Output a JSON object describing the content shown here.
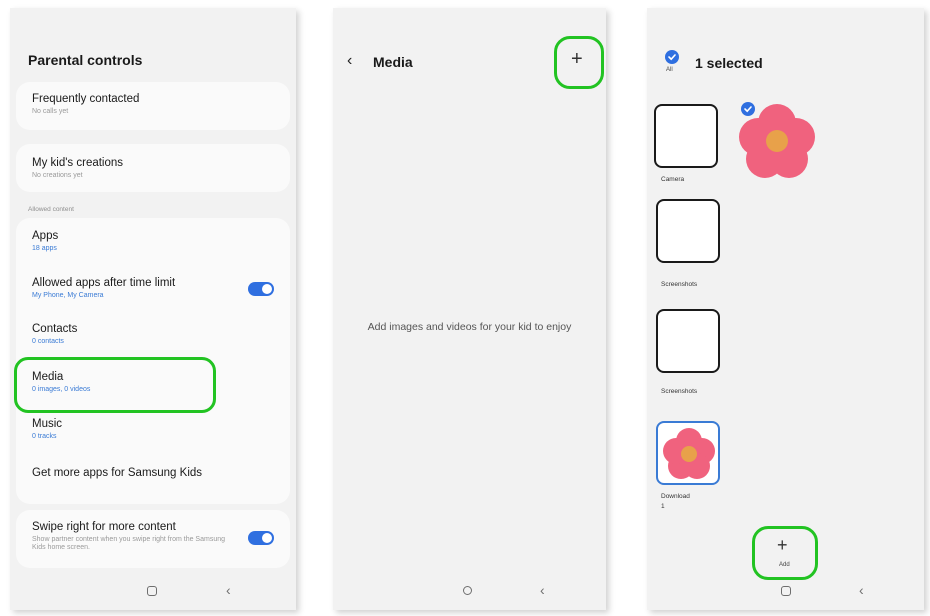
{
  "panel1": {
    "title": "Parental controls",
    "frequently_contacted": {
      "title": "Frequently contacted",
      "sub": "No calls yet"
    },
    "kids_creations": {
      "title": "My kid's creations",
      "sub": "No creations yet"
    },
    "section_label": "Allowed content",
    "apps": {
      "title": "Apps",
      "sub": "18 apps"
    },
    "allowed_apps": {
      "title": "Allowed apps after time limit",
      "sub": "My Phone, My Camera",
      "toggle_on": true
    },
    "contacts": {
      "title": "Contacts",
      "sub": "0 contacts"
    },
    "media": {
      "title": "Media",
      "sub": "0 images, 0 videos"
    },
    "music": {
      "title": "Music",
      "sub": "0 tracks"
    },
    "get_more": {
      "title": "Get more apps for Samsung Kids"
    },
    "swipe": {
      "title": "Swipe right for more content",
      "sub": "Show partner content when you swipe right from the Samsung Kids home screen.",
      "toggle_on": true
    }
  },
  "panel2": {
    "title": "Media",
    "back_icon": "chevron-left-icon",
    "add_icon": "plus-icon",
    "empty_message": "Add images and videos for your kid to enjoy"
  },
  "panel3": {
    "title": "1 selected",
    "all_label": "All",
    "albums": [
      {
        "label": "Camera"
      },
      {
        "label": "Screenshots"
      },
      {
        "label": "Screenshots"
      },
      {
        "label": "Download",
        "count": "1"
      }
    ],
    "add_label": "Add"
  },
  "colors": {
    "highlight": "#22c322",
    "accent": "#2f6fe0",
    "background": "#f2f2f2",
    "card": "#fafafa"
  }
}
